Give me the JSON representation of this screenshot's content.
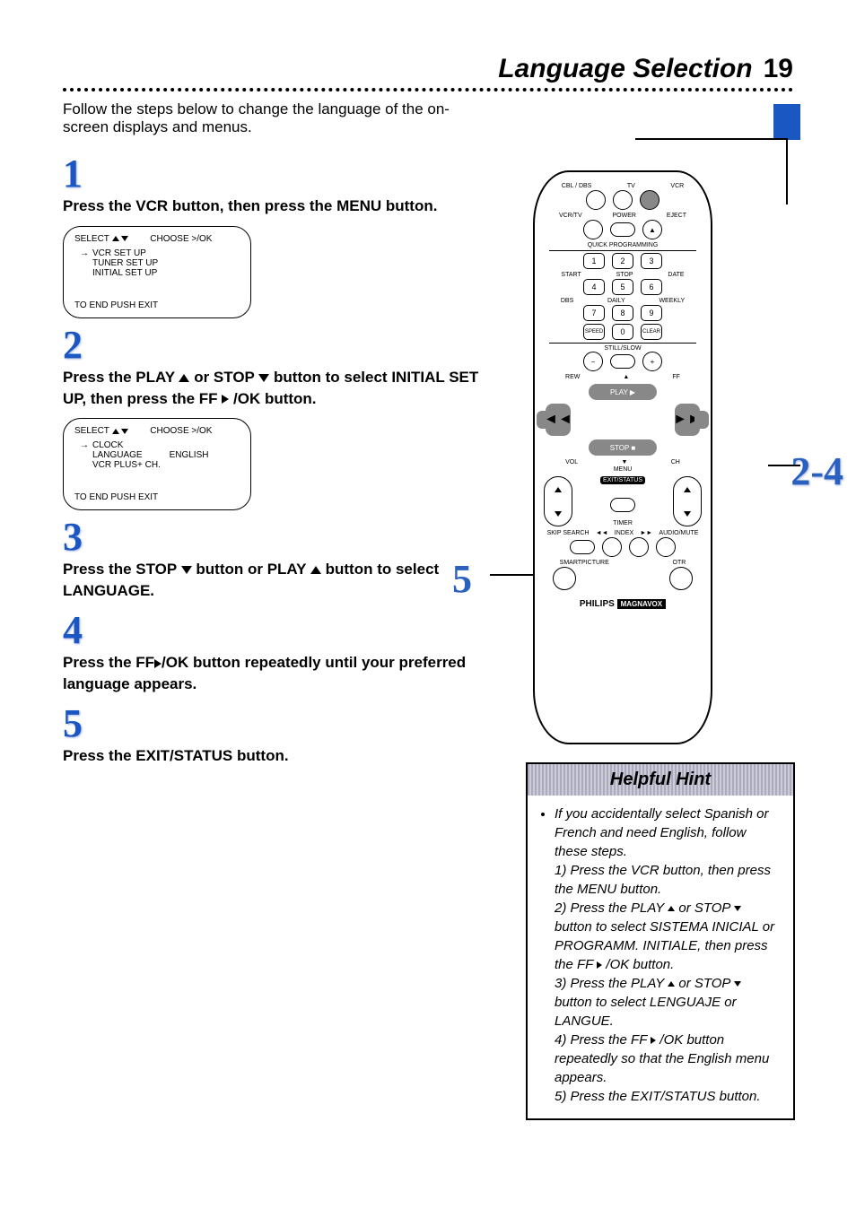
{
  "header": {
    "title": "Language Selection",
    "page": "19"
  },
  "intro": "Follow the steps below to change the language of the on-screen displays and menus.",
  "steps": {
    "n1": "1",
    "h1": "Press the VCR button, then press the MENU button.",
    "osd1": {
      "selLabel": "SELECT",
      "chooseLabel": "CHOOSE >/OK",
      "row1": "VCR SET UP",
      "row2": "TUNER SET UP",
      "row3": "INITIAL SET UP",
      "foot": "TO END PUSH EXIT"
    },
    "n2": "2",
    "h2a": "Press the PLAY ",
    "h2b": " or STOP ",
    "h2c": " button to select INITIAL SET UP, then press the FF ",
    "h2d": " /OK button.",
    "osd2": {
      "selLabel": "SELECT",
      "chooseLabel": "CHOOSE >/OK",
      "row1": "CLOCK",
      "row2": "LANGUAGE",
      "row2v": "ENGLISH",
      "row3": "VCR PLUS+ CH.",
      "foot": "TO END PUSH EXIT"
    },
    "n3": "3",
    "h3a": "Press the STOP ",
    "h3b": " button or PLAY ",
    "h3c": " button to select LANGUAGE.",
    "n4": "4",
    "h4a": "Press the FF",
    "h4b": "/OK button repeatedly until your preferred language appears.",
    "n5": "5",
    "h5": "Press the EXIT/STATUS button."
  },
  "remote": {
    "cbl": "CBL / DBS",
    "tv": "TV",
    "vcr": "VCR",
    "vcrtv": "VCR/TV",
    "power": "POWER",
    "eject": "EJECT",
    "qp": "QUICK PROGRAMMING",
    "b1": "1",
    "b2": "2",
    "b3": "3",
    "b4": "4",
    "b5": "5",
    "b6": "6",
    "b7": "7",
    "b8": "8",
    "b9": "9",
    "b0": "0",
    "start": "START",
    "stop": "STOP",
    "date": "DATE",
    "dbs": "DBS",
    "daily": "DAILY",
    "weekly": "WEEKLY",
    "speed": "SPEED",
    "clear": "CLEAR",
    "still": "STILL/SLOW",
    "minus": "−",
    "plus": "+",
    "rew": "REW",
    "ff": "FF",
    "play": "PLAY ▶",
    "stopb": "STOP ■",
    "vol": "VOL",
    "menu": "MENU",
    "ch": "CH",
    "exit": "EXIT/STATUS",
    "timer": "TIMER",
    "skip": "SKIP SEARCH",
    "index": "INDEX",
    "audio": "AUDIO/MUTE",
    "smart": "SMARTPICTURE",
    "otr": "OTR",
    "brand": "PHILIPS",
    "brand2": "MAGNAVOX"
  },
  "callouts": {
    "c1": "",
    "c24": "2-4",
    "c5": "5"
  },
  "hint": {
    "title": "Helpful Hint",
    "p1": "If you accidentally select Spanish or French and need English, follow these steps.",
    "p2": "1) Press the VCR button, then press the MENU button.",
    "p3a": "2) Press the PLAY ",
    "p3b": " or STOP ",
    "p3c": " button to select SISTEMA INICIAL or PROGRAMM. INITIALE, then press the FF ",
    "p3d": " /OK button.",
    "p4a": "3) Press the PLAY ",
    "p4b": " or STOP ",
    "p4c": " button to select LENGUAJE or LANGUE.",
    "p5a": "4) Press the FF ",
    "p5b": " /OK button repeatedly so that the English menu appears.",
    "p6": "5) Press the EXIT/STATUS button."
  }
}
